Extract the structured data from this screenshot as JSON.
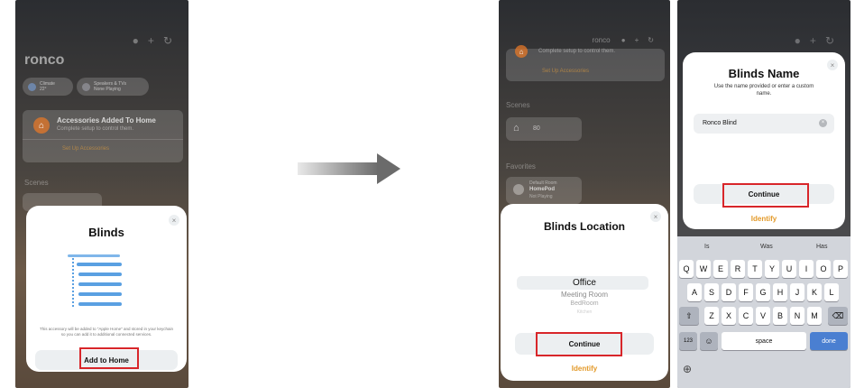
{
  "screen1": {
    "home_name": "ronco",
    "header_icons": [
      "mic-icon",
      "plus-icon",
      "refresh-icon"
    ],
    "pills": [
      {
        "title": "Climate",
        "subtitle": "22°"
      },
      {
        "title": "Speakers & TVs",
        "subtitle": "None Playing"
      }
    ],
    "banner": {
      "title": "Accessories Added To Home",
      "subtitle": "Complete setup to control them.",
      "link": "Set Up Accessories"
    },
    "scenes_label": "Scenes",
    "sheet": {
      "title": "Blinds",
      "close": "×",
      "description": "This accessory will be added to \"Apple Home\" and stored in your keychain so you can add it to additional connected services.",
      "button": "Add to Home"
    }
  },
  "screen2": {
    "header_title": "ronco",
    "banner_sub": "Complete setup to control them.",
    "banner_link": "Set Up Accessories",
    "scenes_label": "Scenes",
    "scene_tile": "80",
    "favorites_label": "Favorites",
    "favorite_tile": {
      "room": "Default Room",
      "name": "HomePod",
      "status": "Not Playing"
    },
    "sheet": {
      "title": "Blinds Location",
      "close": "×",
      "options": [
        "Office",
        "Meeting Room",
        "BedRoom",
        "Kitchen"
      ],
      "button": "Continue",
      "identify": "Identify"
    }
  },
  "screen3": {
    "sheet": {
      "title": "Blinds Name",
      "close": "×",
      "subtitle": "Use the name provided or enter a custom name.",
      "input_value": "Ronco Blind",
      "button": "Continue",
      "identify": "Identify"
    },
    "keyboard": {
      "suggestions": [
        "Is",
        "Was",
        "Has"
      ],
      "row1": [
        "Q",
        "W",
        "E",
        "R",
        "T",
        "Y",
        "U",
        "I",
        "O",
        "P"
      ],
      "row2": [
        "A",
        "S",
        "D",
        "F",
        "G",
        "H",
        "J",
        "K",
        "L"
      ],
      "row3": [
        "Z",
        "X",
        "C",
        "V",
        "B",
        "N",
        "M"
      ],
      "shift": "⇧",
      "backspace": "⌫",
      "numbers": "123",
      "emoji": "☺",
      "space": "space",
      "done": "done",
      "globe": "⊕"
    }
  },
  "colors": {
    "accent_orange": "#e39a2a",
    "highlight_red": "#d8262a",
    "blind_blue": "#5aa0e2",
    "done_blue": "#4a7fd1"
  }
}
